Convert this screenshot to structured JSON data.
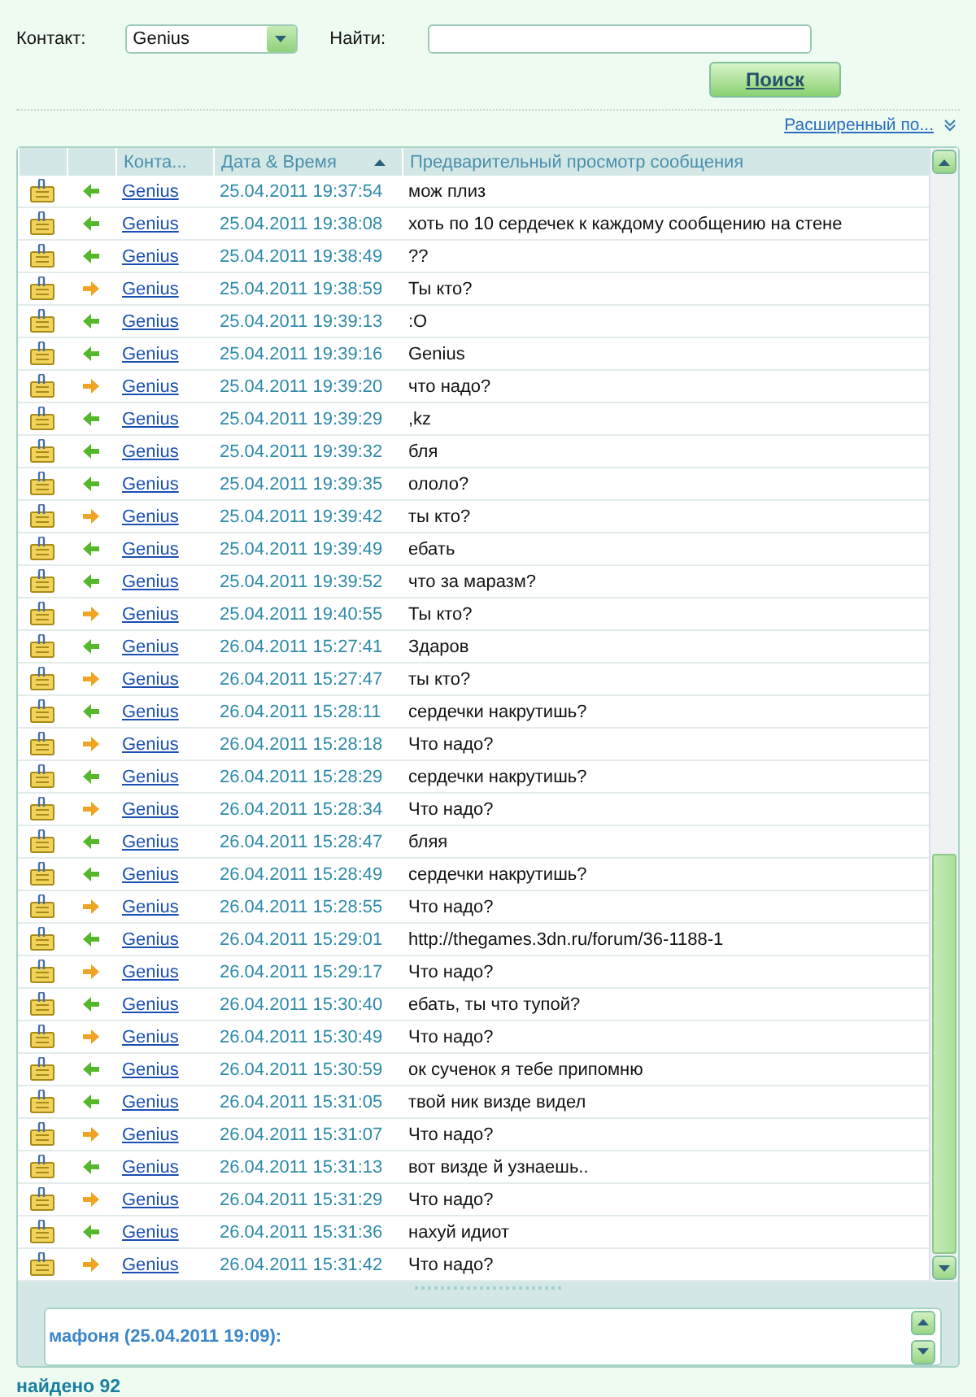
{
  "search": {
    "contact_label": "Контакт:",
    "contact_value": "Genius",
    "find_label": "Найти:",
    "button": "Поиск",
    "advanced_link": "Расширенный по..."
  },
  "table": {
    "columns": [
      "Конта...",
      "Дата & Время",
      "Предварительный просмотр сообщения"
    ],
    "rows": [
      {
        "kind": "in",
        "contact": "Genius",
        "time": "25.04.2011 19:37:54",
        "text": "мож плиз"
      },
      {
        "kind": "in",
        "contact": "Genius",
        "time": "25.04.2011 19:38:08",
        "text": "хоть по 10 сердечек к каждому сообщению на стене"
      },
      {
        "kind": "in",
        "contact": "Genius",
        "time": "25.04.2011 19:38:49",
        "text": "??"
      },
      {
        "kind": "out",
        "contact": "Genius",
        "time": "25.04.2011 19:38:59",
        "text": "Ты кто?"
      },
      {
        "kind": "in",
        "contact": "Genius",
        "time": "25.04.2011 19:39:13",
        "text": ":O"
      },
      {
        "kind": "in",
        "contact": "Genius",
        "time": "25.04.2011 19:39:16",
        "text": "Genius"
      },
      {
        "kind": "out",
        "contact": "Genius",
        "time": "25.04.2011 19:39:20",
        "text": "что надо?"
      },
      {
        "kind": "in",
        "contact": "Genius",
        "time": "25.04.2011 19:39:29",
        "text": ",kz"
      },
      {
        "kind": "in",
        "contact": "Genius",
        "time": "25.04.2011 19:39:32",
        "text": "бля"
      },
      {
        "kind": "in",
        "contact": "Genius",
        "time": "25.04.2011 19:39:35",
        "text": "ололо?"
      },
      {
        "kind": "out",
        "contact": "Genius",
        "time": "25.04.2011 19:39:42",
        "text": "ты кто?"
      },
      {
        "kind": "in",
        "contact": "Genius",
        "time": "25.04.2011 19:39:49",
        "text": "ебать"
      },
      {
        "kind": "in",
        "contact": "Genius",
        "time": "25.04.2011 19:39:52",
        "text": "что за маразм?"
      },
      {
        "kind": "out",
        "contact": "Genius",
        "time": "25.04.2011 19:40:55",
        "text": "Ты кто?"
      },
      {
        "kind": "in",
        "contact": "Genius",
        "time": "26.04.2011 15:27:41",
        "text": "Здаров"
      },
      {
        "kind": "out",
        "contact": "Genius",
        "time": "26.04.2011 15:27:47",
        "text": "ты кто?"
      },
      {
        "kind": "in",
        "contact": "Genius",
        "time": "26.04.2011 15:28:11",
        "text": "сердечки накрутишь?"
      },
      {
        "kind": "out",
        "contact": "Genius",
        "time": "26.04.2011 15:28:18",
        "text": "Что надо?"
      },
      {
        "kind": "in",
        "contact": "Genius",
        "time": "26.04.2011 15:28:29",
        "text": "сердечки накрутишь?"
      },
      {
        "kind": "out",
        "contact": "Genius",
        "time": "26.04.2011 15:28:34",
        "text": "Что надо?"
      },
      {
        "kind": "in",
        "contact": "Genius",
        "time": "26.04.2011 15:28:47",
        "text": "бляя"
      },
      {
        "kind": "in",
        "contact": "Genius",
        "time": "26.04.2011 15:28:49",
        "text": "сердечки накрутишь?"
      },
      {
        "kind": "out",
        "contact": "Genius",
        "time": "26.04.2011 15:28:55",
        "text": "Что надо?"
      },
      {
        "kind": "in",
        "contact": "Genius",
        "time": "26.04.2011 15:29:01",
        "text": "http://thegames.3dn.ru/forum/36-1188-1"
      },
      {
        "kind": "out",
        "contact": "Genius",
        "time": "26.04.2011 15:29:17",
        "text": "Что надо?"
      },
      {
        "kind": "in",
        "contact": "Genius",
        "time": "26.04.2011 15:30:40",
        "text": "ебать, ты что тупой?"
      },
      {
        "kind": "out",
        "contact": "Genius",
        "time": "26.04.2011 15:30:49",
        "text": "Что надо?"
      },
      {
        "kind": "in",
        "contact": "Genius",
        "time": "26.04.2011 15:30:59",
        "text": "ок сученок я тебе припомню"
      },
      {
        "kind": "in",
        "contact": "Genius",
        "time": "26.04.2011 15:31:05",
        "text": "твой ник визде видел"
      },
      {
        "kind": "out",
        "contact": "Genius",
        "time": "26.04.2011 15:31:07",
        "text": "Что надо?"
      },
      {
        "kind": "in",
        "contact": "Genius",
        "time": "26.04.2011 15:31:13",
        "text": "вот визде й узнаешь.."
      },
      {
        "kind": "out",
        "contact": "Genius",
        "time": "26.04.2011 15:31:29",
        "text": "Что надо?"
      },
      {
        "kind": "in",
        "contact": "Genius",
        "time": "26.04.2011 15:31:36",
        "text": "нахуй идиот"
      },
      {
        "kind": "out",
        "contact": "Genius",
        "time": "26.04.2011 15:31:42",
        "text": "Что надо?"
      }
    ]
  },
  "preview": {
    "header": "мафоня (25.04.2011 19:09):"
  },
  "status": "найдено 92"
}
